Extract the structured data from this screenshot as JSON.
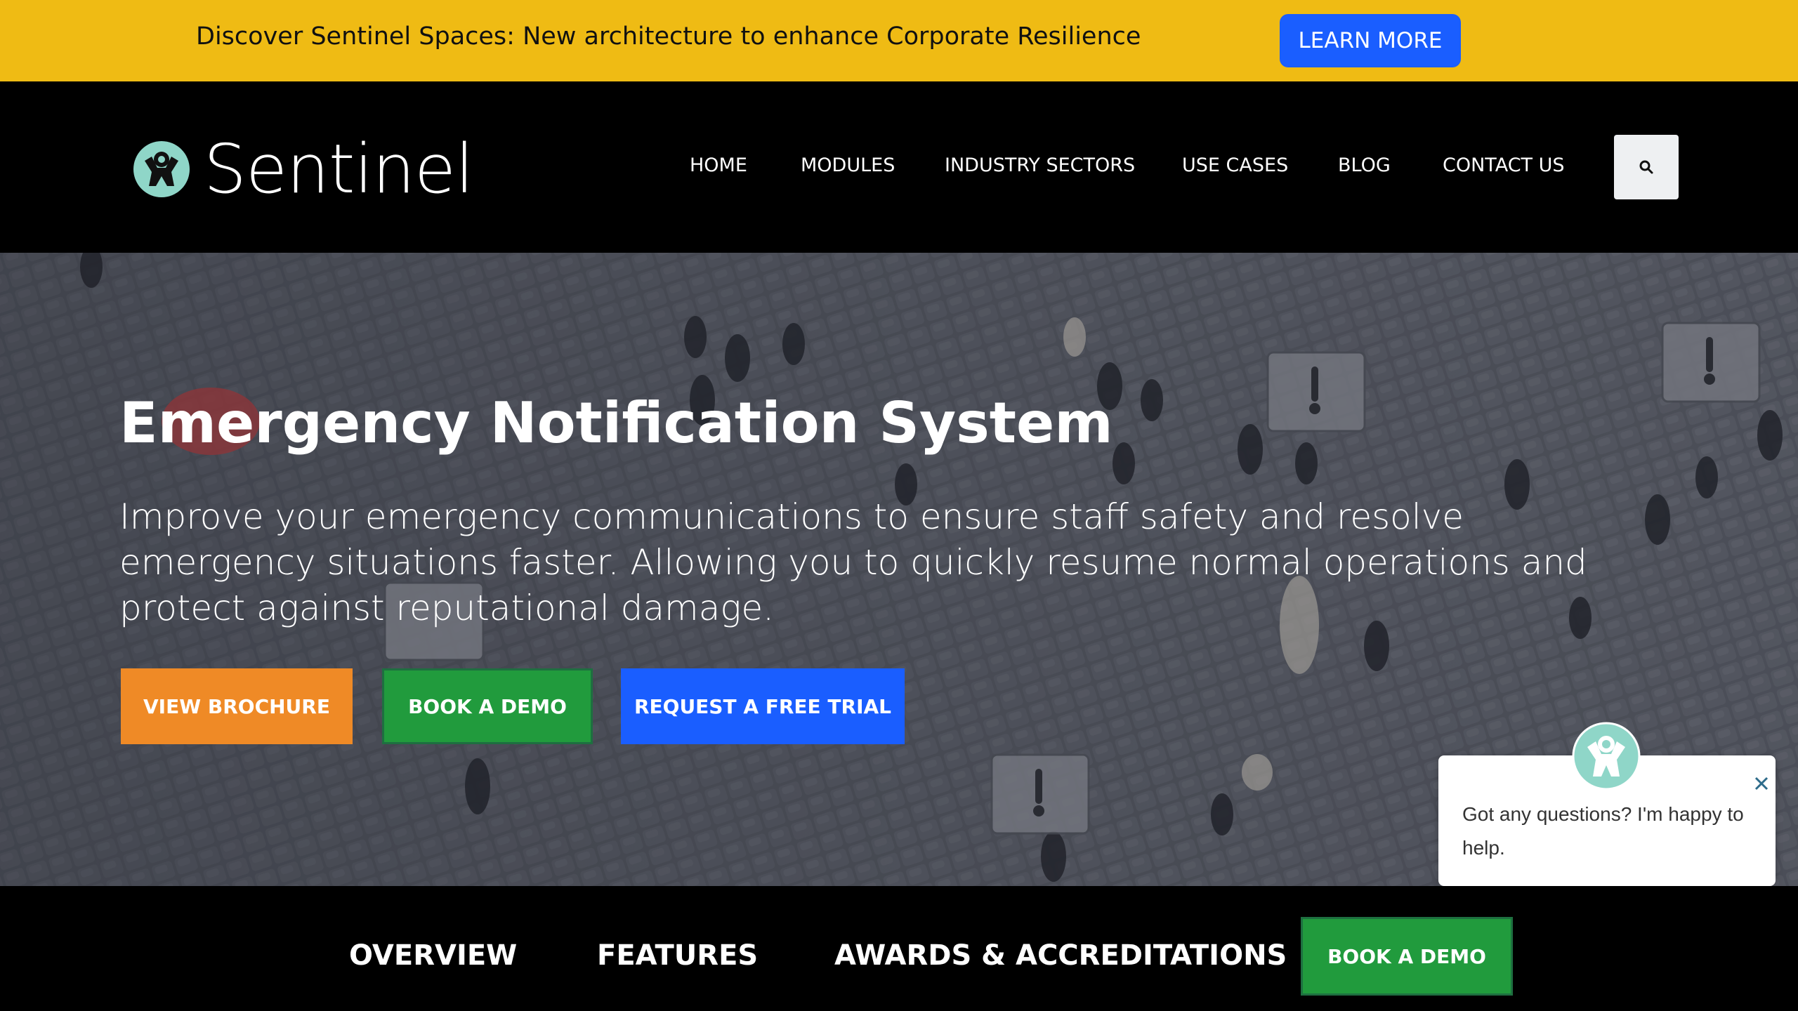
{
  "announcement": {
    "text": "Discover Sentinel Spaces: New architecture to enhance Corporate Resilience",
    "button_label": "LEARN MORE"
  },
  "header": {
    "logo_text": "Sentinel",
    "nav": [
      {
        "label": "HOME"
      },
      {
        "label": "MODULES"
      },
      {
        "label": "INDUSTRY SECTORS"
      },
      {
        "label": "USE CASES"
      },
      {
        "label": "BLOG"
      },
      {
        "label": "CONTACT US"
      }
    ],
    "search_icon": "search-icon"
  },
  "hero": {
    "title": "Emergency Notification System",
    "subtitle": "Improve your emergency communications to ensure staff safety and resolve emergency situations faster. Allowing you to quickly resume normal operations and protect against reputational damage.",
    "buttons": {
      "brochure": "VIEW BROCHURE",
      "demo": "BOOK A DEMO",
      "trial": "REQUEST A FREE TRIAL"
    }
  },
  "chat": {
    "message": "Got any questions? I'm happy to help."
  },
  "subnav": {
    "items": [
      {
        "label": "OVERVIEW"
      },
      {
        "label": "FEATURES"
      },
      {
        "label": "AWARDS & ACCREDITATIONS"
      }
    ],
    "demo_label": "BOOK A DEMO"
  },
  "colors": {
    "announce_bg": "#efbb14",
    "primary_blue": "#1a5eff",
    "orange": "#ef8a26",
    "green": "#219b3d",
    "teal_logo": "#7fd3c3"
  }
}
